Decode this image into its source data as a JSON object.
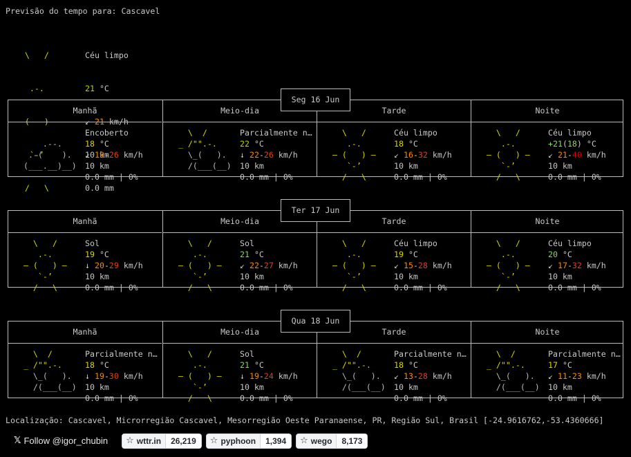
{
  "header": {
    "title": "Previsão do tempo para: Cascavel"
  },
  "current": {
    "art": [
      "    \\   /    ",
      "     .-.     ",
      "  ― (   ) ―  ",
      "     `-’     ",
      "    /   \\    "
    ],
    "condition": "Céu limpo",
    "temp": "21",
    "temp_unit": " °C",
    "wind_arrow": "↙ ",
    "wind": "21",
    "wind_unit": " km/h",
    "visibility": "10 km",
    "precip": "0.0 mm"
  },
  "days": [
    {
      "label": "Seg 16 Jun",
      "periods": [
        {
          "name": "Manhã",
          "art": [
            "",
            "      .--.   ",
            "   .-(    ). ",
            "  (___.__)__)",
            ""
          ],
          "condition": "Encoberto",
          "temp": "18",
          "temp_unit": " °C",
          "wind_arrow": "↙ ",
          "wind_min": "19",
          "wind_max": "26",
          "wind_unit": " km/h",
          "visibility": "10 km",
          "precip": "0.0 mm | 0%"
        },
        {
          "name": "Meio-dia",
          "art": [
            "    \\  /      ",
            "  _ /\"\".-.    ",
            "    \\_(   ).  ",
            "    /(___(__) ",
            ""
          ],
          "condition": "Parcialmente n…",
          "temp": "22",
          "temp_unit": " °C",
          "wind_arrow": "↓ ",
          "wind_min": "22",
          "wind_max": "26",
          "wind_unit": " km/h",
          "visibility": "10 km",
          "precip": "0.0 mm | 0%"
        },
        {
          "name": "Tarde",
          "art": [
            "    \\   /    ",
            "     .-.     ",
            "  ― (   ) ―  ",
            "     `-’     ",
            "    /   \\    "
          ],
          "condition": "Céu limpo",
          "temp": "18",
          "temp_unit": " °C",
          "wind_arrow": "↙ ",
          "wind_min": "16",
          "wind_max": "32",
          "wind_unit": " km/h",
          "visibility": "10 km",
          "precip": "0.0 mm | 0%"
        },
        {
          "name": "Noite",
          "art": [
            "    \\   /    ",
            "     .-.     ",
            "  ― (   ) ―  ",
            "     `-’     ",
            "    /   \\    "
          ],
          "condition": "Céu limpo",
          "temp": "+21",
          "temp_feels": "18",
          "temp_unit": " °C",
          "wind_arrow": "↙ ",
          "wind_min": "21",
          "wind_max": "40",
          "wind_unit": " km/h",
          "visibility": "10 km",
          "precip": "0.0 mm | 0%"
        }
      ]
    },
    {
      "label": "Ter 17 Jun",
      "periods": [
        {
          "name": "Manhã",
          "art": [
            "    \\   /    ",
            "     .-.     ",
            "  ― (   ) ―  ",
            "     `-’     ",
            "    /   \\    "
          ],
          "condition": "Sol",
          "temp": "19",
          "temp_unit": " °C",
          "wind_arrow": "↓ ",
          "wind_min": "20",
          "wind_max": "29",
          "wind_unit": " km/h",
          "visibility": "10 km",
          "precip": "0.0 mm | 0%"
        },
        {
          "name": "Meio-dia",
          "art": [
            "    \\   /    ",
            "     .-.     ",
            "  ― (   ) ―  ",
            "     `-’     ",
            "    /   \\    "
          ],
          "condition": "Sol",
          "temp": "21",
          "temp_unit": " °C",
          "wind_arrow": "↙ ",
          "wind_min": "22",
          "wind_max": "27",
          "wind_unit": " km/h",
          "visibility": "10 km",
          "precip": "0.0 mm | 0%"
        },
        {
          "name": "Tarde",
          "art": [
            "    \\   /    ",
            "     .-.     ",
            "  ― (   ) ―  ",
            "     `-’     ",
            "    /   \\    "
          ],
          "condition": "Céu limpo",
          "temp": "19",
          "temp_unit": " °C",
          "wind_arrow": "↙ ",
          "wind_min": "15",
          "wind_max": "28",
          "wind_unit": " km/h",
          "visibility": "10 km",
          "precip": "0.0 mm | 0%"
        },
        {
          "name": "Noite",
          "art": [
            "    \\   /    ",
            "     .-.     ",
            "  ― (   ) ―  ",
            "     `-’     ",
            "    /   \\    "
          ],
          "condition": "Céu limpo",
          "temp": "20",
          "temp_unit": " °C",
          "wind_arrow": "↙ ",
          "wind_min": "17",
          "wind_max": "32",
          "wind_unit": " km/h",
          "visibility": "10 km",
          "precip": "0.0 mm | 0%"
        }
      ]
    },
    {
      "label": "Qua 18 Jun",
      "periods": [
        {
          "name": "Manhã",
          "art": [
            "    \\  /      ",
            "  _ /\"\".-.    ",
            "    \\_(   ).  ",
            "    /(___(__) ",
            ""
          ],
          "condition": "Parcialmente n…",
          "temp": "18",
          "temp_unit": " °C",
          "wind_arrow": "↓ ",
          "wind_min": "19",
          "wind_max": "30",
          "wind_unit": " km/h",
          "visibility": "10 km",
          "precip": "0.0 mm | 0%"
        },
        {
          "name": "Meio-dia",
          "art": [
            "    \\   /    ",
            "     .-.     ",
            "  ― (   ) ―  ",
            "     `-’     ",
            "    /   \\    "
          ],
          "condition": "Sol",
          "temp": "21",
          "temp_unit": " °C",
          "wind_arrow": "↓ ",
          "wind_min": "19",
          "wind_max": "24",
          "wind_unit": " km/h",
          "visibility": "10 km",
          "precip": "0.0 mm | 0%"
        },
        {
          "name": "Tarde",
          "art": [
            "    \\  /      ",
            "  _ /\"\".-.    ",
            "    \\_(   ).  ",
            "    /(___(__) ",
            ""
          ],
          "condition": "Parcialmente n…",
          "temp": "18",
          "temp_unit": " °C",
          "wind_arrow": "↙ ",
          "wind_min": "13",
          "wind_max": "28",
          "wind_unit": " km/h",
          "visibility": "10 km",
          "precip": "0.0 mm | 0%"
        },
        {
          "name": "Noite",
          "art": [
            "    \\  /      ",
            "  _ /\"\".-.    ",
            "    \\_(   ).  ",
            "    /(___(__) ",
            ""
          ],
          "condition": "Parcialmente n…",
          "temp": "17",
          "temp_unit": " °C",
          "wind_arrow": "↙ ",
          "wind_min": "11",
          "wind_max": "23",
          "wind_unit": " km/h",
          "visibility": "10 km",
          "precip": "0.0 mm | 0%"
        }
      ]
    }
  ],
  "footer": {
    "location": "Localização: Cascavel, Microrregião Cascavel, Mesorregião Oeste Paranaense, PR, Região Sul, Brasil [-24.9616762,-53.4360666]",
    "follow_logo": "𝕏",
    "follow_label": "Follow @igor_chubin",
    "github_buttons": [
      {
        "repo": "wttr.in",
        "count": "26,219"
      },
      {
        "repo": "pyphoon",
        "count": "1,394"
      },
      {
        "repo": "wego",
        "count": "8,173"
      }
    ]
  },
  "colors": {
    "background": "#000000",
    "text": "#c8c8c8",
    "sun": "#d7d700",
    "cloud": "#bcbcbc",
    "border": "#bdbdbd"
  }
}
